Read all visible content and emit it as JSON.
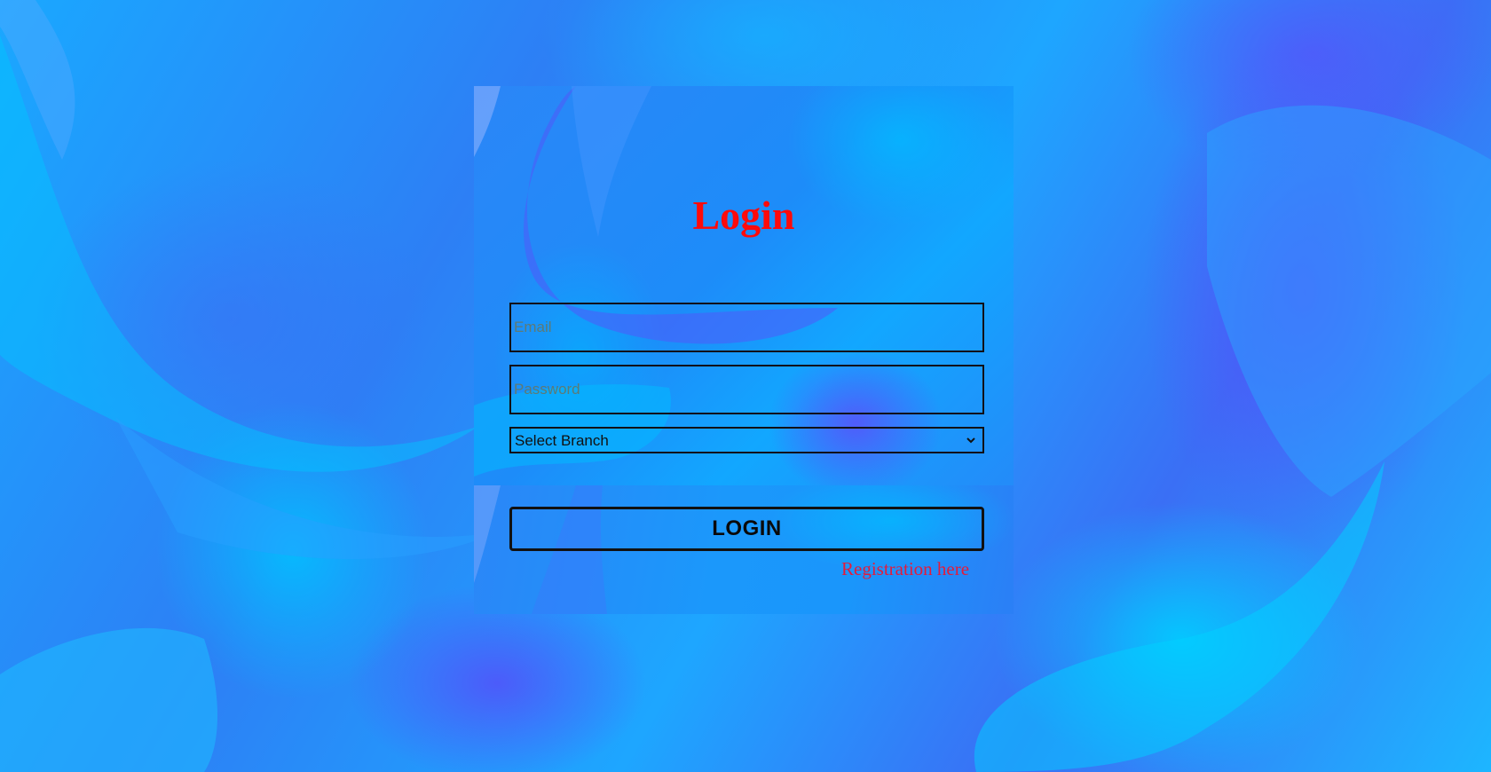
{
  "login_form": {
    "title": "Login",
    "email_placeholder": "Email",
    "password_placeholder": "Password",
    "branch_select": {
      "selected": "Select Branch",
      "options": [
        "Select Branch"
      ]
    },
    "submit_label": "LOGIN",
    "registration_link": "Registration here"
  },
  "colors": {
    "title": "#ff0a0a",
    "link": "#e21c3c",
    "border": "#111111",
    "background_accent_cyan": "#12a7ff",
    "background_accent_violet": "#5550fa"
  }
}
